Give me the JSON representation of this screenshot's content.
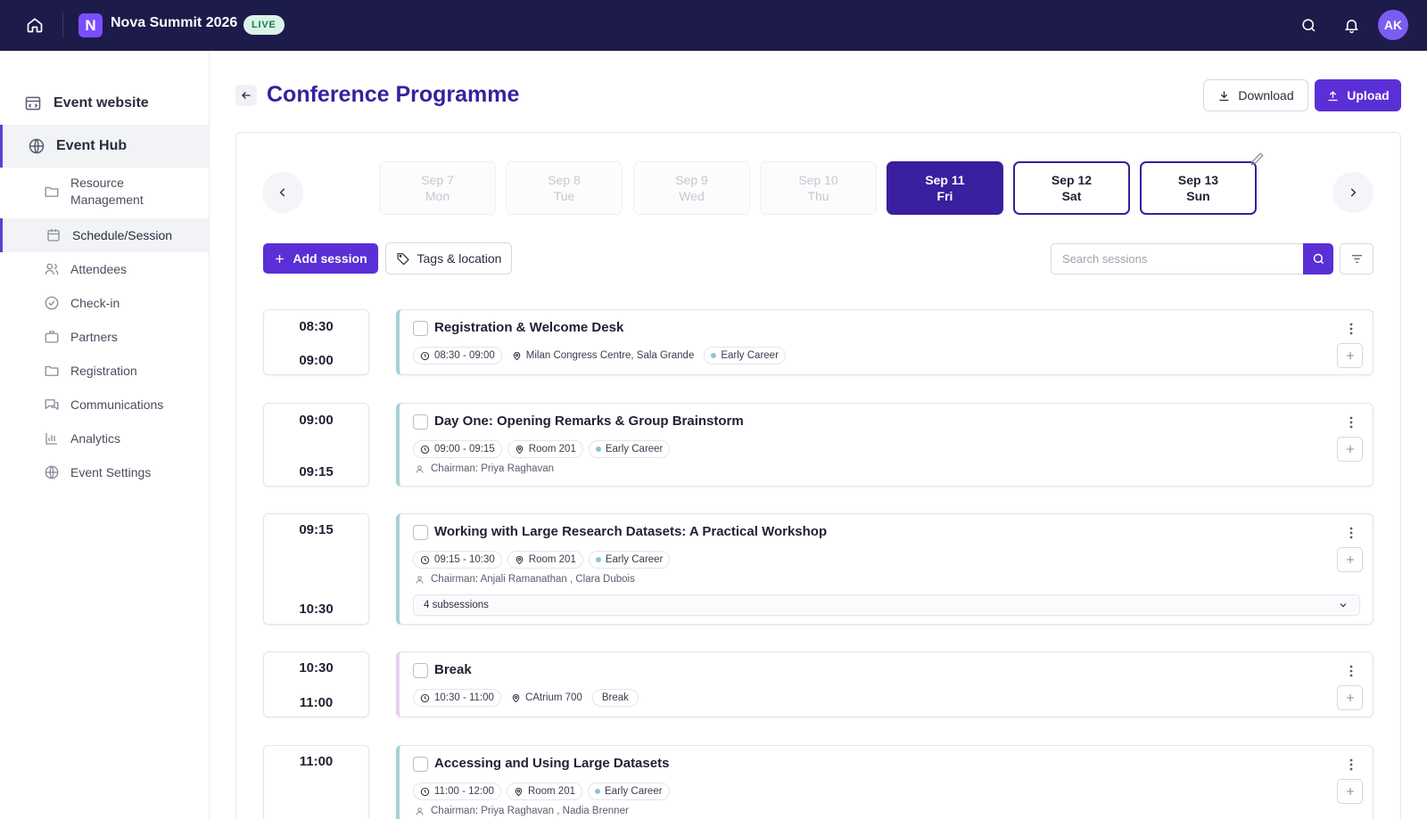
{
  "topbar": {
    "app_logo_letter": "N",
    "app_title": "Nova Summit 2026",
    "live_badge": "LIVE",
    "avatar_initials": "AK"
  },
  "sidebar": {
    "top_items": [
      {
        "label": "Event website",
        "icon": "website-icon"
      },
      {
        "label": "Event Hub",
        "icon": "globe-icon"
      }
    ],
    "items": [
      {
        "label": "Resource Management",
        "icon": "folder-icon"
      },
      {
        "label": "Schedule/Session",
        "icon": "calendar-icon"
      },
      {
        "label": "Attendees",
        "icon": "users-icon"
      },
      {
        "label": "Check-in",
        "icon": "check-circle-icon"
      },
      {
        "label": "Partners",
        "icon": "briefcase-icon"
      },
      {
        "label": "Registration",
        "icon": "folder-icon"
      },
      {
        "label": "Communications",
        "icon": "chat-icon"
      },
      {
        "label": "Analytics",
        "icon": "bar-chart-icon"
      },
      {
        "label": "Event Settings",
        "icon": "globe-icon"
      }
    ]
  },
  "page": {
    "title": "Conference Programme",
    "download_label": "Download",
    "upload_label": "Upload"
  },
  "dates": [
    {
      "date": "Sep 7",
      "day": "Mon",
      "state": "disabled"
    },
    {
      "date": "Sep 8",
      "day": "Tue",
      "state": "disabled"
    },
    {
      "date": "Sep 9",
      "day": "Wed",
      "state": "disabled"
    },
    {
      "date": "Sep 10",
      "day": "Thu",
      "state": "disabled"
    },
    {
      "date": "Sep 11",
      "day": "Fri",
      "state": "active"
    },
    {
      "date": "Sep 12",
      "day": "Sat",
      "state": "normal"
    },
    {
      "date": "Sep 13",
      "day": "Sun",
      "state": "normal"
    }
  ],
  "toolbar": {
    "add_session_label": "Add session",
    "tags_location_label": "Tags & location",
    "search_placeholder": "Search sessions"
  },
  "sessions": [
    {
      "start": "08:30",
      "end": "09:00",
      "title": "Registration & Welcome Desk",
      "time_range": "08:30 - 09:00",
      "location": "Milan Congress Centre, Sala Grande",
      "tag": "Early Career",
      "chairman": "",
      "subsessions": ""
    },
    {
      "start": "09:00",
      "end": "09:15",
      "title": "Day One: Opening Remarks & Group Brainstorm",
      "time_range": "09:00 - 09:15",
      "location": "Room 201",
      "tag": "Early Career",
      "chairman": "Chairman: Priya Raghavan",
      "subsessions": ""
    },
    {
      "start": "09:15",
      "end": "10:30",
      "title": "Working with Large Research Datasets: A Practical Workshop",
      "time_range": "09:15 - 10:30",
      "location": "Room 201",
      "tag": "Early Career",
      "chairman": "Chairman: Anjali Ramanathan , Clara Dubois",
      "subsessions": "4 subsessions"
    },
    {
      "start": "10:30",
      "end": "11:00",
      "title": "Break",
      "time_range": "10:30 - 11:00",
      "location": "CAtrium 700",
      "tag": "Break",
      "chairman": "",
      "subsessions": ""
    },
    {
      "start": "11:00",
      "end": "12:00",
      "title": "Accessing and Using Large Datasets",
      "time_range": "11:00 - 12:00",
      "location": "Room 201",
      "tag": "Early Career",
      "chairman": "Chairman: Priya Raghavan , Nadia Brenner",
      "subsessions": ""
    }
  ],
  "colors": {
    "topbar_bg": "#1c1b4a",
    "primary": "#5b2fd6",
    "title": "#3a1f9e",
    "session_accent": "#a7cfd8",
    "break_accent": "#eacdf2"
  }
}
